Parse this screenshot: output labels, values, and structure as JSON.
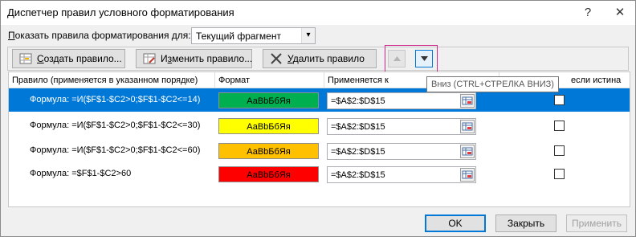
{
  "window": {
    "title": "Диспетчер правил условного форматирования",
    "help": "?",
    "close": "✕"
  },
  "scope": {
    "label_u": "П",
    "label_rest": "оказать правила форматирования для:",
    "value": "Текущий фрагмент"
  },
  "toolbar": {
    "new_u": "С",
    "new_rest": "оздать правило...",
    "edit_pre": "И",
    "edit_u": "з",
    "edit_rest": "менить правило...",
    "delete_u": "У",
    "delete_rest": "далить правило"
  },
  "tooltip": "Вниз (CTRL+СТРЕЛКА ВНИЗ)",
  "columns": {
    "rule": "Правило (применяется в указанном порядке)",
    "format": "Формат",
    "applies": "Применяется к",
    "stop": "если истина"
  },
  "rules": [
    {
      "rule": "Формула: =И($F$1-$C2>0;$F$1-$C2<=14)",
      "preview": "АаВbБбЯя",
      "fill": "#00b050",
      "applies": "=$A$2:$D$15",
      "stop_checked": false,
      "selected": true
    },
    {
      "rule": "Формула: =И($F$1-$C2>0;$F$1-$C2<=30)",
      "preview": "АаВbБбЯя",
      "fill": "#ffff00",
      "applies": "=$A$2:$D$15",
      "stop_checked": false,
      "selected": false
    },
    {
      "rule": "Формула: =И($F$1-$C2>0;$F$1-$C2<=60)",
      "preview": "АаВbБбЯя",
      "fill": "#ffc000",
      "applies": "=$A$2:$D$15",
      "stop_checked": false,
      "selected": false
    },
    {
      "rule": "Формула: =$F$1-$C2>60",
      "preview": "АаВbБбЯя",
      "fill": "#ff0000",
      "applies": "=$A$2:$D$15",
      "stop_checked": false,
      "selected": false
    }
  ],
  "footer": {
    "ok": "OK",
    "close": "Закрыть",
    "apply": "Применить"
  }
}
